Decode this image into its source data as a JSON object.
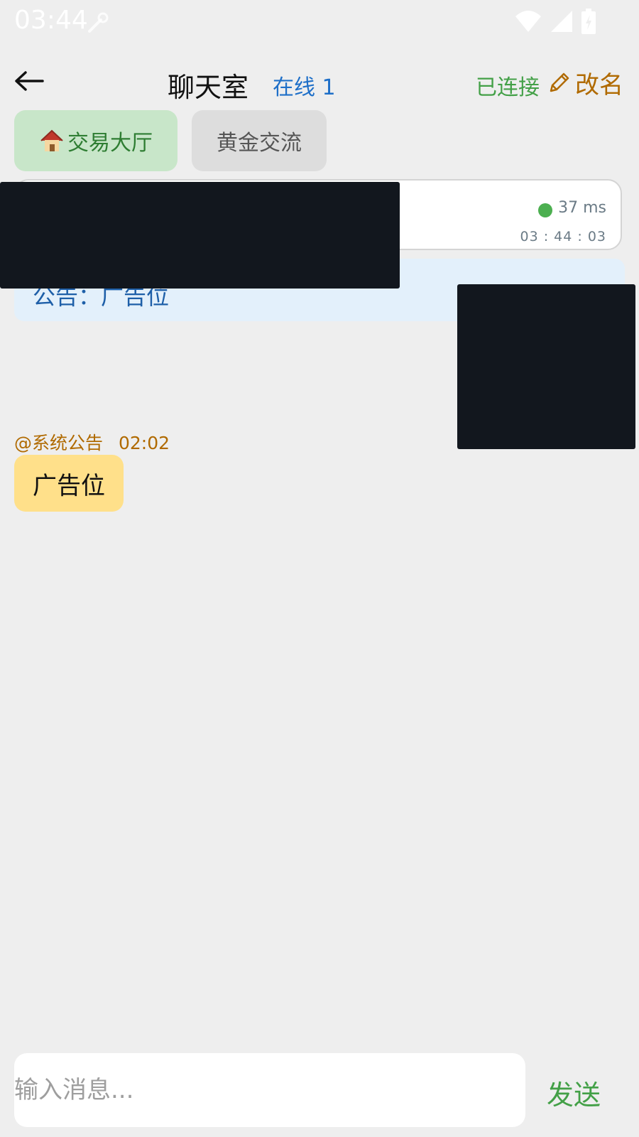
{
  "status_bar": {
    "time": "03:44"
  },
  "header": {
    "title": "聊天室",
    "online": "在线 1",
    "connection_status": "已连接",
    "rename_label": "改名"
  },
  "tabs": [
    {
      "label": "交易大厅",
      "active": true,
      "icon": "house-icon"
    },
    {
      "label": "黄金交流",
      "active": false
    }
  ],
  "ping": {
    "latency": "37 ms",
    "time": "03 : 44 : 03",
    "status_color": "#4caf50"
  },
  "notice": {
    "text": "公告：广告位"
  },
  "messages": [
    {
      "sender": "@系统公告",
      "time": "02:02",
      "text": "广告位"
    }
  ],
  "composer": {
    "placeholder": "输入消息...",
    "send_label": "发送"
  },
  "colors": {
    "background": "#eeeeee",
    "accent_green": "#43a047",
    "accent_blue": "#1e6fc8",
    "accent_orange": "#b06a00",
    "bubble": "#ffe08a"
  }
}
